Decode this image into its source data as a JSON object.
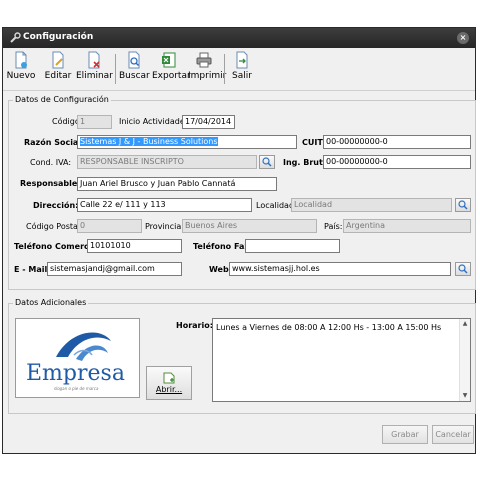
{
  "window": {
    "title": "Configuración",
    "close_glyph": "×"
  },
  "toolbar": {
    "items": [
      {
        "label": "Nuevo",
        "icon": "new-document-icon"
      },
      {
        "label": "Editar",
        "icon": "edit-document-icon"
      },
      {
        "label": "Eliminar",
        "icon": "delete-document-icon"
      },
      {
        "label": "Buscar",
        "icon": "search-document-icon"
      },
      {
        "label": "Exportar",
        "icon": "excel-export-icon"
      },
      {
        "label": "Imprimir",
        "icon": "printer-icon"
      },
      {
        "label": "Salir",
        "icon": "exit-icon"
      }
    ]
  },
  "config": {
    "group_title": "Datos de Configuración",
    "codigo_label": "Código:",
    "codigo_value": "1",
    "inicio_label": "Inicio Actividades:",
    "inicio_value": "17/04/2014",
    "razon_label": "Razón Social:",
    "razon_value": "Sistemas J & J - Business Solutions",
    "cuit_label": "CUIT:",
    "cuit_value": "00-00000000-0",
    "iva_label": "Cond. IVA:",
    "iva_value": "RESPONSABLE INSCRIPTO",
    "ingbrutos_label": "Ing. Brutos:",
    "ingbrutos_value": "00-00000000-0",
    "responsables_label": "Responsables:",
    "responsables_value": "Juan Ariel Brusco y Juan Pablo Cannatá",
    "direccion_label": "Dirección:",
    "direccion_value": "Calle 22 e/ 111 y 113",
    "localidad_label": "Localidad:",
    "localidad_value": "Localidad",
    "cp_label": "Código Postal:",
    "cp_value": "0",
    "provincia_label": "Provincia:",
    "provincia_value": "Buenos Aires",
    "pais_label": "País:",
    "pais_value": "Argentina",
    "telcom_label": "Teléfono Comercial:",
    "telcom_value": "10101010",
    "telfax_label": "Teléfono Fax:",
    "telfax_value": "",
    "email_label": "E - Mail:",
    "email_value": "sistemasjandj@gmail.com",
    "web_label": "Web:",
    "web_value": "www.sistemasjj.hol.es"
  },
  "additional": {
    "group_title": "Datos Adicionales",
    "logo_text": "Empresa",
    "logo_tagline": "slogan o pie de marca",
    "open_button": "Abrir...",
    "horario_label": "Horario:",
    "horario_value": "Lunes a Viernes de 08:00 A 12:00 Hs - 13:00 A 15:00 Hs"
  },
  "actions": {
    "save": "Grabar",
    "cancel": "Cancelar"
  },
  "colors": {
    "titlebar": "#2e2e2e",
    "selection": "#3399ff",
    "disabled_bg": "#e3e3e3"
  }
}
